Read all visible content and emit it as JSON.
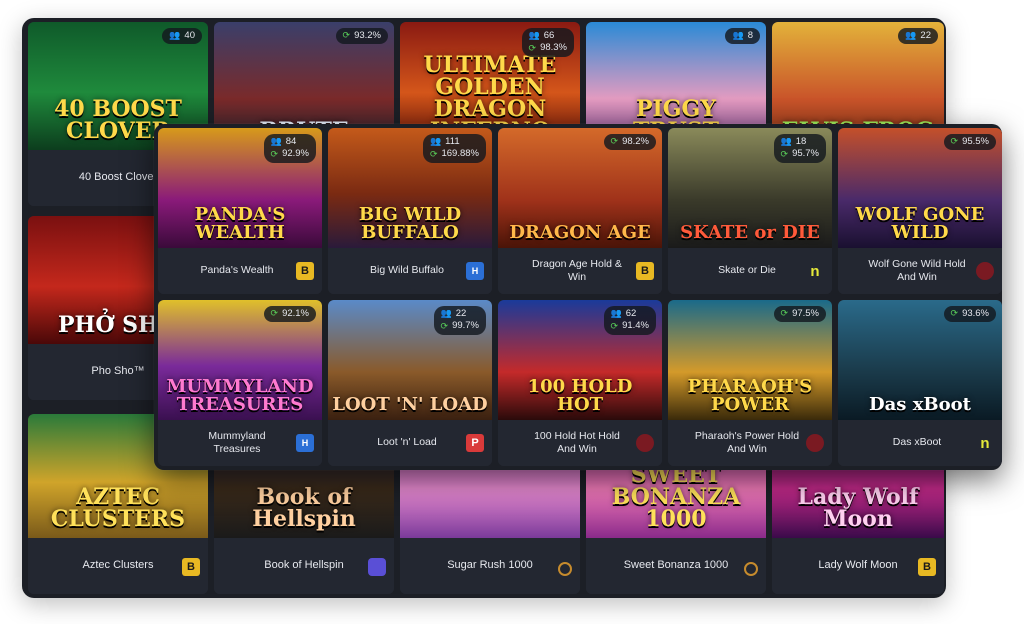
{
  "back_tiles": [
    {
      "caption": "40 Boost Clover",
      "art_title": "40 BOOST CLOVER",
      "players": "40",
      "rtp": "",
      "provider": "none"
    },
    {
      "caption": "",
      "art_title": "BRUTE",
      "players": "",
      "rtp": "93.2%",
      "provider": "none"
    },
    {
      "caption": "",
      "art_title": "ULTIMATE GOLDEN DRAGON INFERNO",
      "players": "66",
      "rtp": "98.3%",
      "provider": "none"
    },
    {
      "caption": "",
      "art_title": "PIGGY TRUST",
      "players": "8",
      "rtp": "",
      "provider": "none"
    },
    {
      "caption": "",
      "art_title": "ELVIS FROG",
      "players": "22",
      "rtp": "",
      "provider": "none"
    },
    {
      "caption": "Pho Sho™",
      "art_title": "PHỞ SHO",
      "players": "",
      "rtp": "",
      "provider": "none"
    },
    {
      "caption": "Aztec Clusters",
      "art_title": "AZTEC CLUSTERS",
      "players": "",
      "rtp": "",
      "provider": "b"
    },
    {
      "caption": "Book of Hellspin",
      "art_title": "Book of Hellspin",
      "players": "",
      "rtp": "",
      "provider": "hs"
    },
    {
      "caption": "Sugar Rush 1000",
      "art_title": "",
      "players": "",
      "rtp": "",
      "provider": "circ"
    },
    {
      "caption": "Sweet Bonanza 1000",
      "art_title": "SWEET BONANZA 1000",
      "players": "",
      "rtp": "",
      "provider": "circ"
    },
    {
      "caption": "Lady Wolf Moon",
      "art_title": "Lady Wolf Moon",
      "players": "",
      "rtp": "",
      "provider": "b"
    }
  ],
  "front_tiles": [
    {
      "caption": "Panda's Wealth",
      "art_title": "PANDA'S WEALTH",
      "players": "84",
      "rtp": "92.9%",
      "provider": "b"
    },
    {
      "caption": "Big Wild Buffalo",
      "art_title": "BIG WILD BUFFALO",
      "players": "111",
      "rtp": "169.88%",
      "provider": "h"
    },
    {
      "caption": "Dragon Age Hold & Win",
      "art_title": "DRAGON AGE",
      "players": "",
      "rtp": "98.2%",
      "provider": "b"
    },
    {
      "caption": "Skate or Die",
      "art_title": "SKATE or DIE",
      "players": "18",
      "rtp": "95.7%",
      "provider": "n"
    },
    {
      "caption": "Wolf Gone Wild Hold And Win",
      "art_title": "WOLF GONE WILD",
      "players": "",
      "rtp": "95.5%",
      "provider": "red"
    },
    {
      "caption": "Mummyland Treasures",
      "art_title": "MUMMYLAND TREASURES",
      "players": "",
      "rtp": "92.1%",
      "provider": "h"
    },
    {
      "caption": "Loot 'n' Load",
      "art_title": "LOOT 'N' LOAD",
      "players": "22",
      "rtp": "99.7%",
      "provider": "p"
    },
    {
      "caption": "100 Hold Hot Hold And Win",
      "art_title": "100 HOLD HOT",
      "players": "62",
      "rtp": "91.4%",
      "provider": "red"
    },
    {
      "caption": "Pharaoh's Power Hold And Win",
      "art_title": "PHARAOH'S POWER",
      "players": "",
      "rtp": "97.5%",
      "provider": "red"
    },
    {
      "caption": "Das xBoot",
      "art_title": "Das xBoot",
      "players": "",
      "rtp": "93.6%",
      "provider": "n"
    }
  ],
  "provider_glyphs": {
    "b": "B",
    "n": "n",
    "h": "H",
    "p": "P",
    "red": "",
    "circ": "",
    "hs": "",
    "none": ""
  },
  "colors": {
    "panel": "#1c1f26",
    "caption": "#232731",
    "badge_green": "#5ad15a"
  }
}
